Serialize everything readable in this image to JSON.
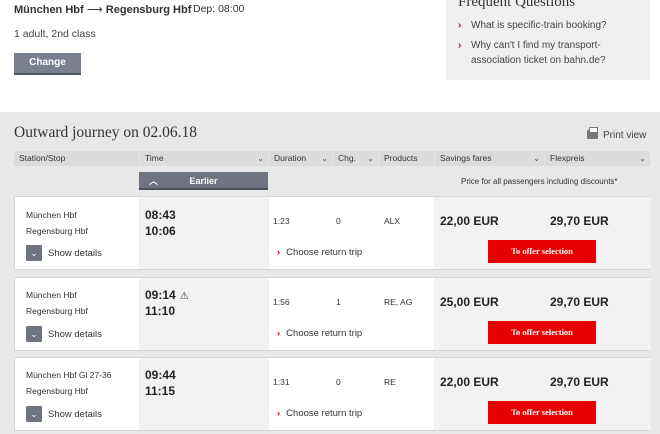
{
  "search": {
    "from": "München Hbf",
    "to": "Regensburg Hbf",
    "departure": "Dep: 08:00",
    "passengers": "1 adult, 2nd class",
    "change_label": "Change"
  },
  "faq": {
    "title": "Frequent Questions",
    "links": [
      "What is specific-train booking?",
      "Why can't I find my transport-association ticket on bahn.de?"
    ]
  },
  "journey": {
    "title": "Outward journey on 02.06.18",
    "print_label": "Print view",
    "columns": [
      "Station/Stop",
      "Time",
      "Duration",
      "Chg.",
      "Products",
      "Savings fares",
      "Flexpreis"
    ],
    "earlier_label": "Earlier",
    "price_note": "Price for all passengers including discounts*",
    "show_details": "Show details",
    "choose_return": "Choose return trip",
    "offer_label": "To offer selection",
    "rows": [
      {
        "from": "München Hbf",
        "to": "Regensburg Hbf",
        "dep": "08:43",
        "arr": "10:06",
        "duration": "1:23",
        "changes": "0",
        "products": "ALX",
        "savings": "22,00 EUR",
        "flex": "29,70 EUR",
        "warning": ""
      },
      {
        "from": "München Hbf",
        "to": "Regensburg Hbf",
        "dep": "09:14",
        "arr": "11:10",
        "duration": "1:56",
        "changes": "1",
        "products": "RE, AG",
        "savings": "25,00 EUR",
        "flex": "29,70 EUR",
        "warning": "⚠"
      },
      {
        "from": "München Hbf Gl 27-36",
        "to": "Regensburg Hbf",
        "dep": "09:44",
        "arr": "11:15",
        "duration": "1:31",
        "changes": "0",
        "products": "RE",
        "savings": "22,00 EUR",
        "flex": "29,70 EUR",
        "warning": ""
      }
    ]
  },
  "colors": {
    "accent_red": "#e60000",
    "button_gray": "#7a8090",
    "header_gray": "#dcdcdc"
  }
}
